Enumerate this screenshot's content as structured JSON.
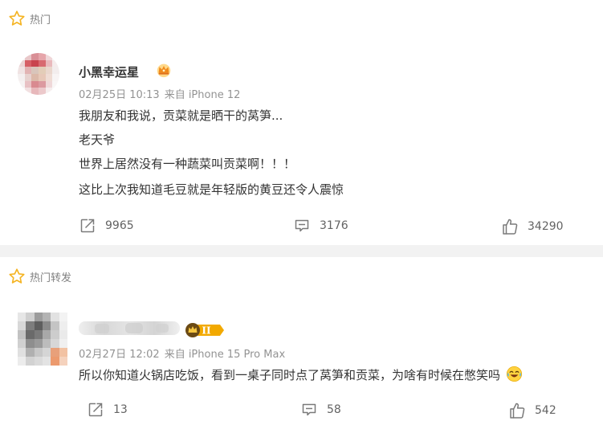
{
  "section1": {
    "label": "热门"
  },
  "comment1": {
    "username": "小黑幸运星",
    "date": "02月25日 10:13",
    "source": "来自 iPhone 12",
    "lines": [
      "我朋友和我说，贡菜就是晒干的莴笋...",
      "老天爷",
      "世界上居然没有一种蔬菜叫贡菜啊！！！",
      "这比上次我知道毛豆就是年轻版的黄豆还令人震惊"
    ],
    "reposts": "9965",
    "comments": "3176",
    "likes": "34290"
  },
  "section2": {
    "label": "热门转发"
  },
  "comment2": {
    "badge_level": "II",
    "date": "02月27日 12:02",
    "source": "来自 iPhone 15 Pro Max",
    "text": "所以你知道火锅店吃饭，看到一桌子同时点了莴笋和贡菜，为啥有时候在憋笑吗",
    "reposts": "13",
    "comments": "58",
    "likes": "542"
  },
  "colors": {
    "star": "#f5b423",
    "badge_gold": "#f2a900",
    "page_bg": "#f2f2f2",
    "text": "#333333",
    "meta": "#939393"
  },
  "icons": [
    "star-icon",
    "crown-badge-icon",
    "repost-icon",
    "comment-icon",
    "like-icon",
    "laughing-tears-emoji"
  ]
}
